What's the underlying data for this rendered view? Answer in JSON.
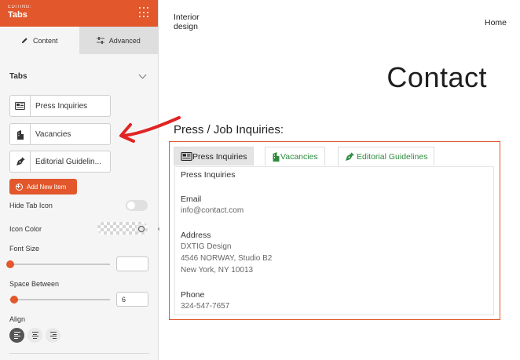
{
  "colors": {
    "accent": "#e2572b",
    "tab_text_green": "#2e8b3e",
    "arrow_red": "#e02424"
  },
  "panel": {
    "editing_label": "EDITING:",
    "title": "Tabs",
    "header_icon": "grid-dots-icon",
    "tabs": [
      {
        "label": "Content",
        "icon": "pencil-icon",
        "active": true
      },
      {
        "label": "Advanced",
        "icon": "sliders-icon",
        "active": false
      }
    ],
    "section_title": "Tabs",
    "items": [
      {
        "label": "Press Inquiries",
        "icon": "newspaper-icon"
      },
      {
        "label": "Vacancies",
        "icon": "building-icon"
      },
      {
        "label": "Editorial Guidelin...",
        "icon": "pen-nib-icon"
      }
    ],
    "add_button_label": "Add New Item",
    "hide_tab_icon_label": "Hide Tab Icon",
    "hide_tab_icon_on": false,
    "icon_color_label": "Icon Color",
    "font_size_label": "Font Size",
    "font_size_value": "",
    "space_between_label": "Space Between",
    "space_between_value": "6",
    "align_label": "Align",
    "align_options": [
      "left",
      "center",
      "right"
    ],
    "align_selected": "left"
  },
  "preview": {
    "logo_line1": "Interior",
    "logo_line2": "design",
    "nav_home": "Home",
    "page_title": "Contact",
    "section_title": "Press / Job Inquiries:",
    "tabs": [
      {
        "label": "Press Inquiries",
        "icon": "newspaper-icon",
        "active": true
      },
      {
        "label": "Vacancies",
        "icon": "building-icon",
        "active": false
      },
      {
        "label": "Editorial Guidelines",
        "icon": "pen-nib-icon",
        "active": false
      }
    ],
    "panel": {
      "heading": "Press Inquiries",
      "email_label": "Email",
      "email_value": "info@contact.com",
      "address_label": "Address",
      "address_line1": "DXTIG Design",
      "address_line2": "4546 NORWAY, Studio B2",
      "address_line3": "New York, NY 10013",
      "phone_label": "Phone",
      "phone_value": "324-547-7657"
    }
  }
}
